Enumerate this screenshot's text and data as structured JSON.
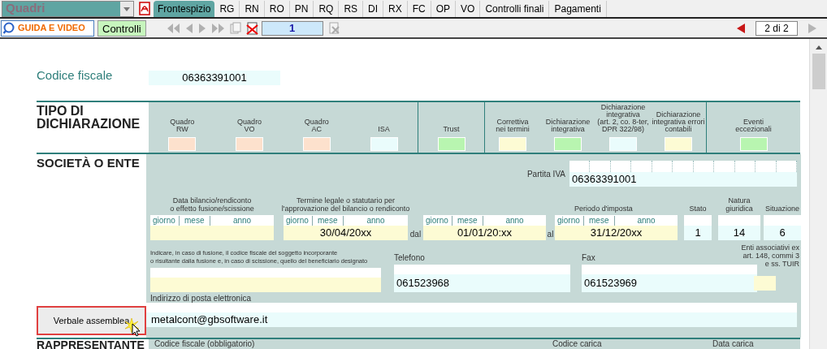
{
  "quadri_dropdown": {
    "value": "Quadri"
  },
  "tabs": [
    {
      "label": "Frontespizio",
      "selected": true
    },
    {
      "label": "RG",
      "selected": false
    },
    {
      "label": "RN",
      "selected": false
    },
    {
      "label": "RO",
      "selected": false
    },
    {
      "label": "PN",
      "selected": false
    },
    {
      "label": "RQ",
      "selected": false
    },
    {
      "label": "RS",
      "selected": false
    },
    {
      "label": "DI",
      "selected": false
    },
    {
      "label": "RX",
      "selected": false
    },
    {
      "label": "FC",
      "selected": false
    },
    {
      "label": "OP",
      "selected": false
    },
    {
      "label": "VO",
      "selected": false
    },
    {
      "label": "Controlli finali",
      "selected": false
    },
    {
      "label": "Pagamenti",
      "selected": false
    }
  ],
  "toolbar": {
    "guide_button": "GUIDA E VIDEO",
    "controls_button": "Controlli",
    "page_field": "1",
    "page_counter": "2 di 2"
  },
  "codice_fiscale": {
    "label": "Codice fiscale",
    "value": "06363391001"
  },
  "tipo_dichiarazione": {
    "title": "TIPO DI\nDICHIARAZIONE",
    "groups": [
      [
        {
          "label": "Quadro\nRW",
          "color": "#fde1cd"
        },
        {
          "label": "Quadro\nVO",
          "color": "#fde1cd"
        },
        {
          "label": "Quadro\nAC",
          "color": "#fde1cd"
        },
        {
          "label": "ISA",
          "color": "#eafcfc"
        }
      ],
      [
        {
          "label": "Trust",
          "color": "#b8f5b0"
        }
      ],
      [
        {
          "label": "Correttiva\nnei termini",
          "color": "#fdfbd4"
        },
        {
          "label": "Dichiarazione\nintegrativa",
          "color": "#b8f5b0"
        },
        {
          "label": "Dichiarazione\nintegrativa\n(art. 2, co. 8-ter,\nDPR 322/98)",
          "color": "#eafcfc"
        },
        {
          "label": "Dichiarazione\nintegrativa errori\ncontabili",
          "color": "#fdfbd4"
        }
      ],
      [
        {
          "label": "Eventi\neccezionali",
          "color": "#b8f5b0"
        }
      ]
    ]
  },
  "societa": {
    "title": "SOCIETÀ O ENTE",
    "partita_iva": {
      "label": "Partita IVA",
      "value": "06363391001"
    },
    "data_bilancio": {
      "label": "Data bilancio/rendiconto\no effetto fusione/scissione",
      "sublabels": [
        "giorno",
        "mese",
        "anno"
      ]
    },
    "termine": {
      "label": "Termine legale o statutario per\nl'approvazione del bilancio o rendiconto",
      "sublabels": [
        "giorno",
        "mese",
        "anno"
      ],
      "value": "30/04/20xx"
    },
    "periodo": {
      "label": "Periodo d'imposta",
      "from_label": "dal",
      "from": {
        "sublabels": [
          "giorno",
          "mese",
          "anno"
        ],
        "value": "01/01/20:xx"
      },
      "to_label": "al",
      "to": {
        "sublabels": [
          "giorno",
          "mese",
          "anno"
        ],
        "value": "31/12/20xx"
      }
    },
    "stato": {
      "label": "Stato",
      "value": "1"
    },
    "natura": {
      "label": "Natura\ngiuridica",
      "value": "14"
    },
    "situazione": {
      "label": "Situazione",
      "value": "6"
    },
    "fusione": {
      "label": "Indicare, in caso di fusione, il codice fiscale del soggetto incorporante\no risultante dalla fusione e, in caso di scissione, quello del beneficiario designato"
    },
    "telefono": {
      "label": "Telefono",
      "value": "061523968"
    },
    "fax": {
      "label": "Fax",
      "value": "061523969"
    },
    "enti": {
      "label": "Enti associativi ex\nart. 148, commi 3\ne ss. TUIR"
    },
    "email": {
      "label": "Indirizzo di posta elettronica",
      "value": "metalcont@gbsoftware.it"
    }
  },
  "verbale_button": "Verbale assemblea",
  "rappresentante": {
    "title": "RAPPRESENTANTE",
    "codice_fiscale_label": "Codice fiscale (obbligatorio)",
    "codice_carica_label": "Codice carica",
    "data_carica_label": "Data carica"
  }
}
